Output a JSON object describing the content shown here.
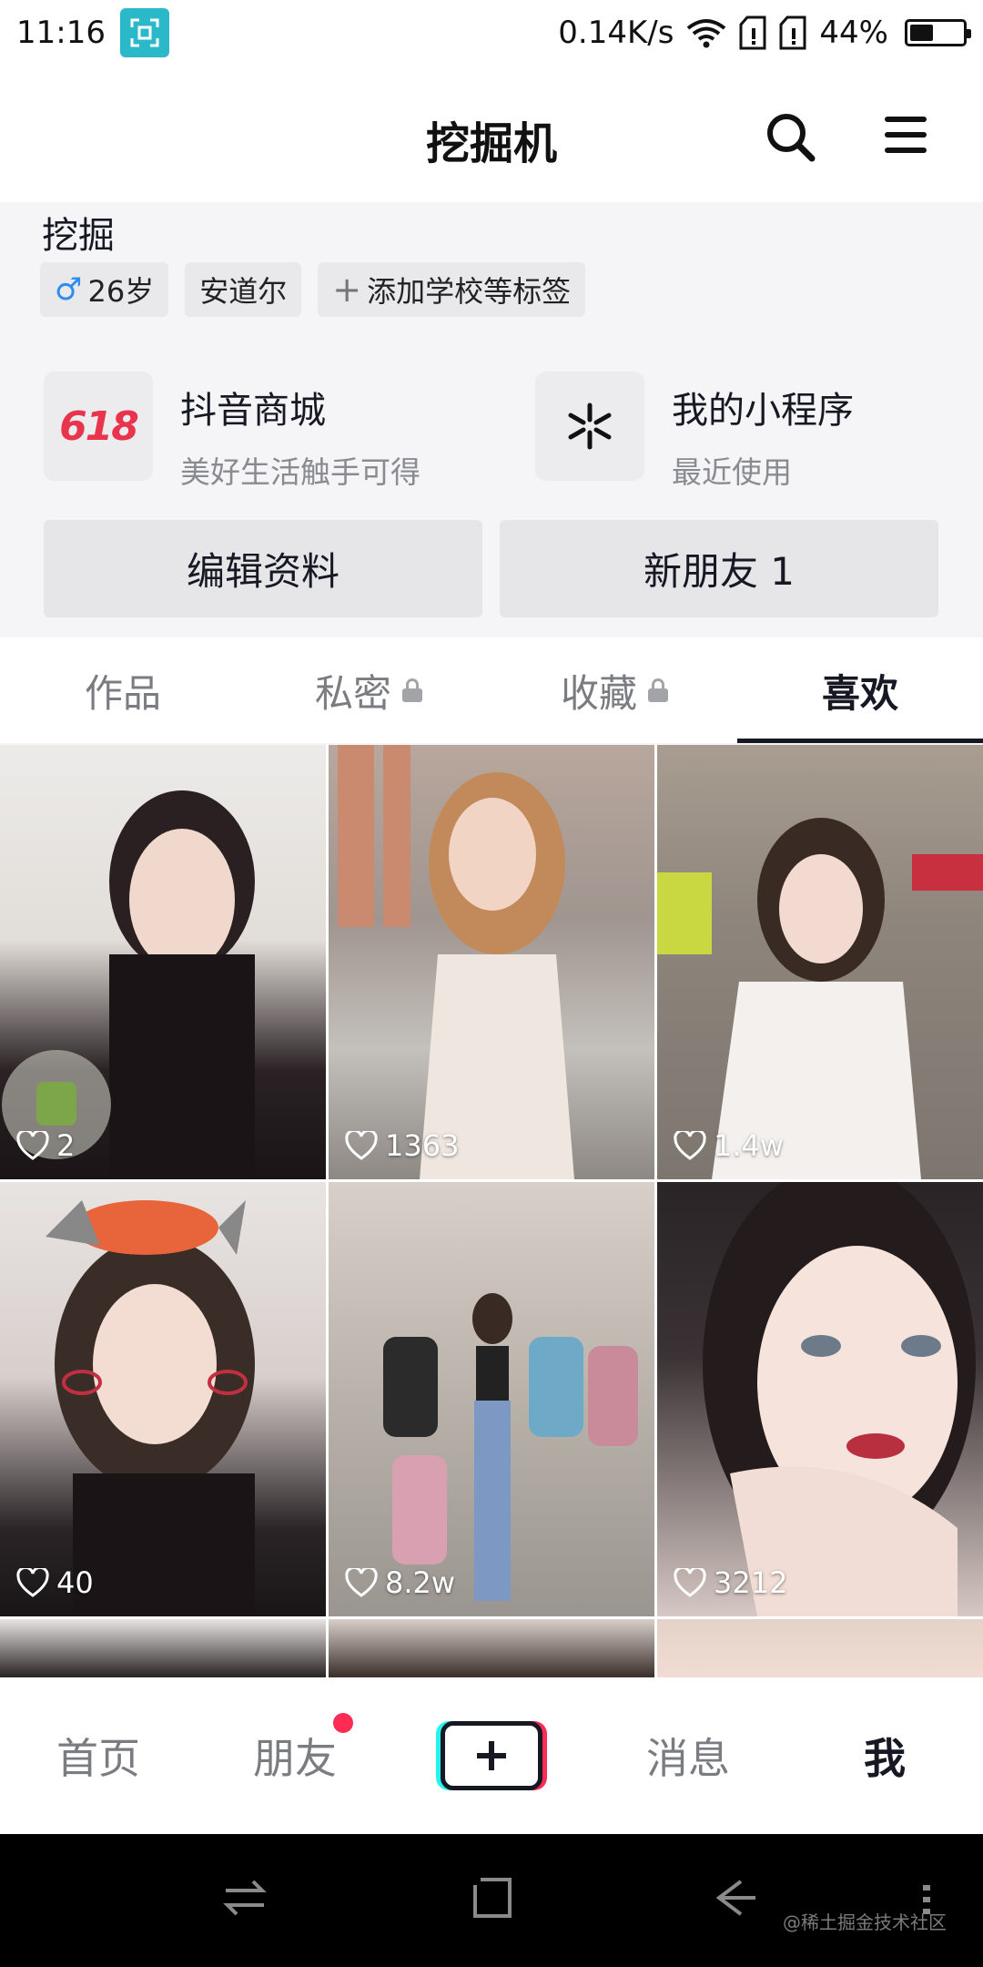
{
  "status_bar": {
    "time": "11:16",
    "network_speed": "0.14K/s",
    "battery": "44%",
    "battery_level": 0.44,
    "icons": [
      "screen-capture-icon",
      "wifi-icon",
      "sim-icon",
      "sim-icon",
      "battery-icon"
    ]
  },
  "header": {
    "title": "挖掘机",
    "search_icon": "search-icon",
    "menu_icon": "menu-icon"
  },
  "profile": {
    "name": "挖掘",
    "tags": [
      {
        "icon": "♂",
        "label": "26岁"
      },
      {
        "label": "安道尔"
      },
      {
        "icon": "+",
        "label": "添加学校等标签"
      }
    ],
    "services": [
      {
        "badge": "618",
        "title": "抖音商城",
        "subtitle": "美好生活触手可得"
      },
      {
        "icon": "mini-program-icon",
        "title": "我的小程序",
        "subtitle": "最近使用"
      }
    ],
    "edit_button": "编辑资料",
    "new_friends_button": "新朋友 1"
  },
  "tabs": [
    {
      "label": "作品",
      "locked": false,
      "active": false
    },
    {
      "label": "私密",
      "locked": true,
      "active": false
    },
    {
      "label": "收藏",
      "locked": true,
      "active": false
    },
    {
      "label": "喜欢",
      "locked": false,
      "active": true
    }
  ],
  "videos": [
    {
      "likes": "2"
    },
    {
      "likes": "1363"
    },
    {
      "likes": "1.4w"
    },
    {
      "likes": "40"
    },
    {
      "likes": "8.2w"
    },
    {
      "likes": "3212"
    }
  ],
  "bottom_nav": {
    "home": "首页",
    "friends": "朋友",
    "create_icon": "plus-icon",
    "messages": "消息",
    "me": "我"
  },
  "system_nav": {
    "watermark": "@稀土掘金技术社区"
  }
}
